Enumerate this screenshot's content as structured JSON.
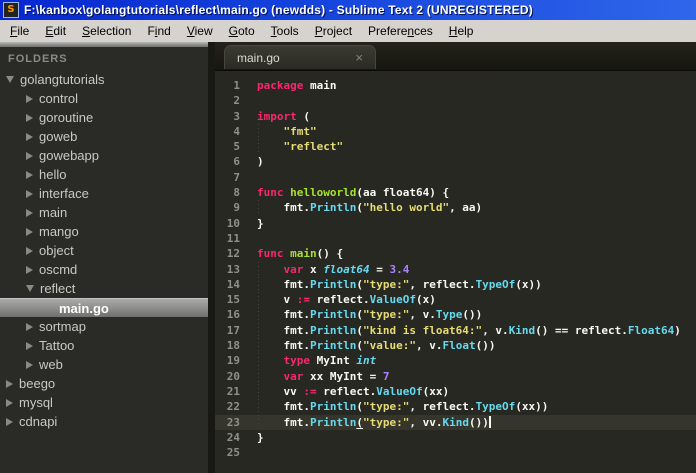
{
  "window": {
    "title": "F:\\kanbox\\golangtutorials\\reflect\\main.go (newdds) - Sublime Text 2 (UNREGISTERED)",
    "app_icon_letter": "S"
  },
  "menu": {
    "items": [
      {
        "label": "File",
        "underline_index": 0
      },
      {
        "label": "Edit",
        "underline_index": 0
      },
      {
        "label": "Selection",
        "underline_index": 0
      },
      {
        "label": "Find",
        "underline_index": 1
      },
      {
        "label": "View",
        "underline_index": 0
      },
      {
        "label": "Goto",
        "underline_index": 0
      },
      {
        "label": "Tools",
        "underline_index": 0
      },
      {
        "label": "Project",
        "underline_index": 0
      },
      {
        "label": "Preferences",
        "underline_index": 7
      },
      {
        "label": "Help",
        "underline_index": 0
      }
    ]
  },
  "sidebar": {
    "header": "FOLDERS",
    "items": [
      {
        "label": "golangtutorials",
        "level": 0,
        "arrow": "down",
        "type": "folder",
        "selected": false
      },
      {
        "label": "control",
        "level": 1,
        "arrow": "right",
        "type": "folder",
        "selected": false
      },
      {
        "label": "goroutine",
        "level": 1,
        "arrow": "right",
        "type": "folder",
        "selected": false
      },
      {
        "label": "goweb",
        "level": 1,
        "arrow": "right",
        "type": "folder",
        "selected": false
      },
      {
        "label": "gowebapp",
        "level": 1,
        "arrow": "right",
        "type": "folder",
        "selected": false
      },
      {
        "label": "hello",
        "level": 1,
        "arrow": "right",
        "type": "folder",
        "selected": false
      },
      {
        "label": "interface",
        "level": 1,
        "arrow": "right",
        "type": "folder",
        "selected": false
      },
      {
        "label": "main",
        "level": 1,
        "arrow": "right",
        "type": "folder",
        "selected": false
      },
      {
        "label": "mango",
        "level": 1,
        "arrow": "right",
        "type": "folder",
        "selected": false
      },
      {
        "label": "object",
        "level": 1,
        "arrow": "right",
        "type": "folder",
        "selected": false
      },
      {
        "label": "oscmd",
        "level": 1,
        "arrow": "right",
        "type": "folder",
        "selected": false
      },
      {
        "label": "reflect",
        "level": 1,
        "arrow": "down",
        "type": "folder",
        "selected": false
      },
      {
        "label": "main.go",
        "level": 2,
        "arrow": "none",
        "type": "file",
        "selected": true
      },
      {
        "label": "sortmap",
        "level": 1,
        "arrow": "right",
        "type": "folder",
        "selected": false
      },
      {
        "label": "Tattoo",
        "level": 1,
        "arrow": "right",
        "type": "folder",
        "selected": false
      },
      {
        "label": "web",
        "level": 1,
        "arrow": "right",
        "type": "folder",
        "selected": false
      },
      {
        "label": "beego",
        "level": 0,
        "arrow": "right",
        "type": "folder",
        "selected": false
      },
      {
        "label": "mysql",
        "level": 0,
        "arrow": "right",
        "type": "folder",
        "selected": false
      },
      {
        "label": "cdnapi",
        "level": 0,
        "arrow": "right",
        "type": "folder",
        "selected": false
      }
    ]
  },
  "tab": {
    "label": "main.go",
    "close_icon": "×",
    "active": true
  },
  "editor": {
    "token_colors": {
      "kw": "#f92672",
      "fn": "#a6e22e",
      "str": "#e6db74",
      "typ": "#66d9ef",
      "mth": "#66d9ef",
      "num": "#ae81ff",
      "pln": "#f8f8f2",
      "ul": "#f8f8f2"
    },
    "background": "#272822",
    "line_highlight": "#35352b",
    "gutter_color": "#8f9089",
    "lines": [
      {
        "n": 1,
        "guide": false,
        "hl": false,
        "segs": [
          {
            "t": "package",
            "c": "kw"
          },
          {
            "t": " main",
            "c": "pln"
          }
        ]
      },
      {
        "n": 2,
        "guide": false,
        "hl": false,
        "segs": []
      },
      {
        "n": 3,
        "guide": false,
        "hl": false,
        "segs": [
          {
            "t": "import",
            "c": "kw"
          },
          {
            "t": " (",
            "c": "pln"
          }
        ]
      },
      {
        "n": 4,
        "guide": true,
        "hl": false,
        "segs": [
          {
            "t": "    ",
            "c": "pln"
          },
          {
            "t": "\"fmt\"",
            "c": "str"
          }
        ]
      },
      {
        "n": 5,
        "guide": true,
        "hl": false,
        "segs": [
          {
            "t": "    ",
            "c": "pln"
          },
          {
            "t": "\"reflect\"",
            "c": "str"
          }
        ]
      },
      {
        "n": 6,
        "guide": false,
        "hl": false,
        "segs": [
          {
            "t": ")",
            "c": "pln"
          }
        ]
      },
      {
        "n": 7,
        "guide": false,
        "hl": false,
        "segs": []
      },
      {
        "n": 8,
        "guide": false,
        "hl": false,
        "segs": [
          {
            "t": "func",
            "c": "kw"
          },
          {
            "t": " ",
            "c": "pln"
          },
          {
            "t": "helloworld",
            "c": "fn"
          },
          {
            "t": "(aa float64) {",
            "c": "pln"
          }
        ]
      },
      {
        "n": 9,
        "guide": true,
        "hl": false,
        "segs": [
          {
            "t": "    fmt.",
            "c": "pln"
          },
          {
            "t": "Println",
            "c": "mth"
          },
          {
            "t": "(",
            "c": "pln"
          },
          {
            "t": "\"hello world\"",
            "c": "str"
          },
          {
            "t": ", aa)",
            "c": "pln"
          }
        ]
      },
      {
        "n": 10,
        "guide": false,
        "hl": false,
        "segs": [
          {
            "t": "}",
            "c": "pln"
          }
        ]
      },
      {
        "n": 11,
        "guide": false,
        "hl": false,
        "segs": []
      },
      {
        "n": 12,
        "guide": false,
        "hl": false,
        "segs": [
          {
            "t": "func",
            "c": "kw"
          },
          {
            "t": " ",
            "c": "pln"
          },
          {
            "t": "main",
            "c": "fn"
          },
          {
            "t": "() {",
            "c": "pln"
          }
        ]
      },
      {
        "n": 13,
        "guide": true,
        "hl": false,
        "segs": [
          {
            "t": "    ",
            "c": "pln"
          },
          {
            "t": "var",
            "c": "kw"
          },
          {
            "t": " x ",
            "c": "pln"
          },
          {
            "t": "float64",
            "c": "typ"
          },
          {
            "t": " = ",
            "c": "pln"
          },
          {
            "t": "3.4",
            "c": "num"
          }
        ]
      },
      {
        "n": 14,
        "guide": true,
        "hl": false,
        "segs": [
          {
            "t": "    fmt.",
            "c": "pln"
          },
          {
            "t": "Println",
            "c": "mth"
          },
          {
            "t": "(",
            "c": "pln"
          },
          {
            "t": "\"type:\"",
            "c": "str"
          },
          {
            "t": ", reflect.",
            "c": "pln"
          },
          {
            "t": "TypeOf",
            "c": "mth"
          },
          {
            "t": "(x))",
            "c": "pln"
          }
        ]
      },
      {
        "n": 15,
        "guide": true,
        "hl": false,
        "segs": [
          {
            "t": "    v ",
            "c": "pln"
          },
          {
            "t": ":=",
            "c": "kw"
          },
          {
            "t": " reflect.",
            "c": "pln"
          },
          {
            "t": "ValueOf",
            "c": "mth"
          },
          {
            "t": "(x)",
            "c": "pln"
          }
        ]
      },
      {
        "n": 16,
        "guide": true,
        "hl": false,
        "segs": [
          {
            "t": "    fmt.",
            "c": "pln"
          },
          {
            "t": "Println",
            "c": "mth"
          },
          {
            "t": "(",
            "c": "pln"
          },
          {
            "t": "\"type:\"",
            "c": "str"
          },
          {
            "t": ", v.",
            "c": "pln"
          },
          {
            "t": "Type",
            "c": "mth"
          },
          {
            "t": "())",
            "c": "pln"
          }
        ]
      },
      {
        "n": 17,
        "guide": true,
        "hl": false,
        "segs": [
          {
            "t": "    fmt.",
            "c": "pln"
          },
          {
            "t": "Println",
            "c": "mth"
          },
          {
            "t": "(",
            "c": "pln"
          },
          {
            "t": "\"kind is float64:\"",
            "c": "str"
          },
          {
            "t": ", v.",
            "c": "pln"
          },
          {
            "t": "Kind",
            "c": "mth"
          },
          {
            "t": "() == reflect.",
            "c": "pln"
          },
          {
            "t": "Float64",
            "c": "mth"
          },
          {
            "t": ")",
            "c": "pln"
          }
        ]
      },
      {
        "n": 18,
        "guide": true,
        "hl": false,
        "segs": [
          {
            "t": "    fmt.",
            "c": "pln"
          },
          {
            "t": "Println",
            "c": "mth"
          },
          {
            "t": "(",
            "c": "pln"
          },
          {
            "t": "\"value:\"",
            "c": "str"
          },
          {
            "t": ", v.",
            "c": "pln"
          },
          {
            "t": "Float",
            "c": "mth"
          },
          {
            "t": "())",
            "c": "pln"
          }
        ]
      },
      {
        "n": 19,
        "guide": true,
        "hl": false,
        "segs": [
          {
            "t": "    ",
            "c": "pln"
          },
          {
            "t": "type",
            "c": "kw"
          },
          {
            "t": " MyInt ",
            "c": "pln"
          },
          {
            "t": "int",
            "c": "typ"
          }
        ]
      },
      {
        "n": 20,
        "guide": true,
        "hl": false,
        "segs": [
          {
            "t": "    ",
            "c": "pln"
          },
          {
            "t": "var",
            "c": "kw"
          },
          {
            "t": " xx MyInt = ",
            "c": "pln"
          },
          {
            "t": "7",
            "c": "num"
          }
        ]
      },
      {
        "n": 21,
        "guide": true,
        "hl": false,
        "segs": [
          {
            "t": "    vv ",
            "c": "pln"
          },
          {
            "t": ":=",
            "c": "kw"
          },
          {
            "t": " reflect.",
            "c": "pln"
          },
          {
            "t": "ValueOf",
            "c": "mth"
          },
          {
            "t": "(xx)",
            "c": "pln"
          }
        ]
      },
      {
        "n": 22,
        "guide": true,
        "hl": false,
        "segs": [
          {
            "t": "    fmt.",
            "c": "pln"
          },
          {
            "t": "Println",
            "c": "mth"
          },
          {
            "t": "(",
            "c": "pln"
          },
          {
            "t": "\"type:\"",
            "c": "str"
          },
          {
            "t": ", reflect.",
            "c": "pln"
          },
          {
            "t": "TypeOf",
            "c": "mth"
          },
          {
            "t": "(xx))",
            "c": "pln"
          }
        ]
      },
      {
        "n": 23,
        "guide": true,
        "hl": true,
        "segs": [
          {
            "t": "    fmt.",
            "c": "pln"
          },
          {
            "t": "Println",
            "c": "mth"
          },
          {
            "t": "(",
            "c": "ul"
          },
          {
            "t": "\"type:\"",
            "c": "str"
          },
          {
            "t": ", vv.",
            "c": "pln"
          },
          {
            "t": "Kind",
            "c": "mth"
          },
          {
            "t": "())",
            "c": "pln"
          },
          {
            "t": "",
            "c": "cursor"
          }
        ]
      },
      {
        "n": 24,
        "guide": false,
        "hl": false,
        "segs": [
          {
            "t": "}",
            "c": "pln"
          }
        ]
      },
      {
        "n": 25,
        "guide": false,
        "hl": false,
        "segs": []
      }
    ]
  }
}
